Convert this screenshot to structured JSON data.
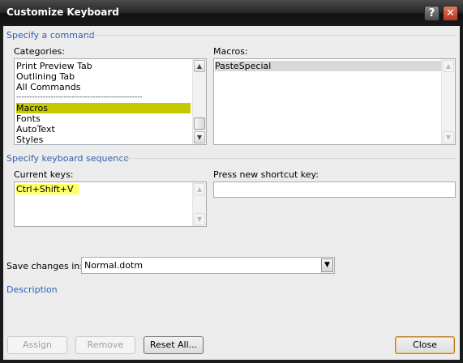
{
  "window": {
    "title": "Customize Keyboard"
  },
  "title_buttons": {
    "help": "?",
    "close": "✕"
  },
  "sections": {
    "command": "Specify a command",
    "keyboard": "Specify keyboard sequence",
    "description": "Description"
  },
  "categories": {
    "label": "Categories:",
    "items": [
      "Print Preview Tab",
      "Outlining Tab",
      "All Commands",
      "------------------------------------------------",
      "Macros",
      "Fonts",
      "AutoText",
      "Styles"
    ],
    "selected": "Macros",
    "highlight_color": "#c8c800"
  },
  "macros": {
    "label": "Macros:",
    "items": [
      "PasteSpecial"
    ],
    "selected": "PasteSpecial"
  },
  "current_keys": {
    "label": "Current keys:",
    "items": [
      "Ctrl+Shift+V"
    ],
    "highlight_color": "#ffff66"
  },
  "new_shortcut": {
    "label": "Press new shortcut key:",
    "value": ""
  },
  "save_changes": {
    "label": "Save changes in:",
    "value": "Normal.dotm"
  },
  "buttons": {
    "assign": "Assign",
    "remove": "Remove",
    "reset_all": "Reset All...",
    "close": "Close"
  },
  "icons": {
    "scroll_up": "▲",
    "scroll_down": "▼",
    "dropdown": "▼"
  }
}
